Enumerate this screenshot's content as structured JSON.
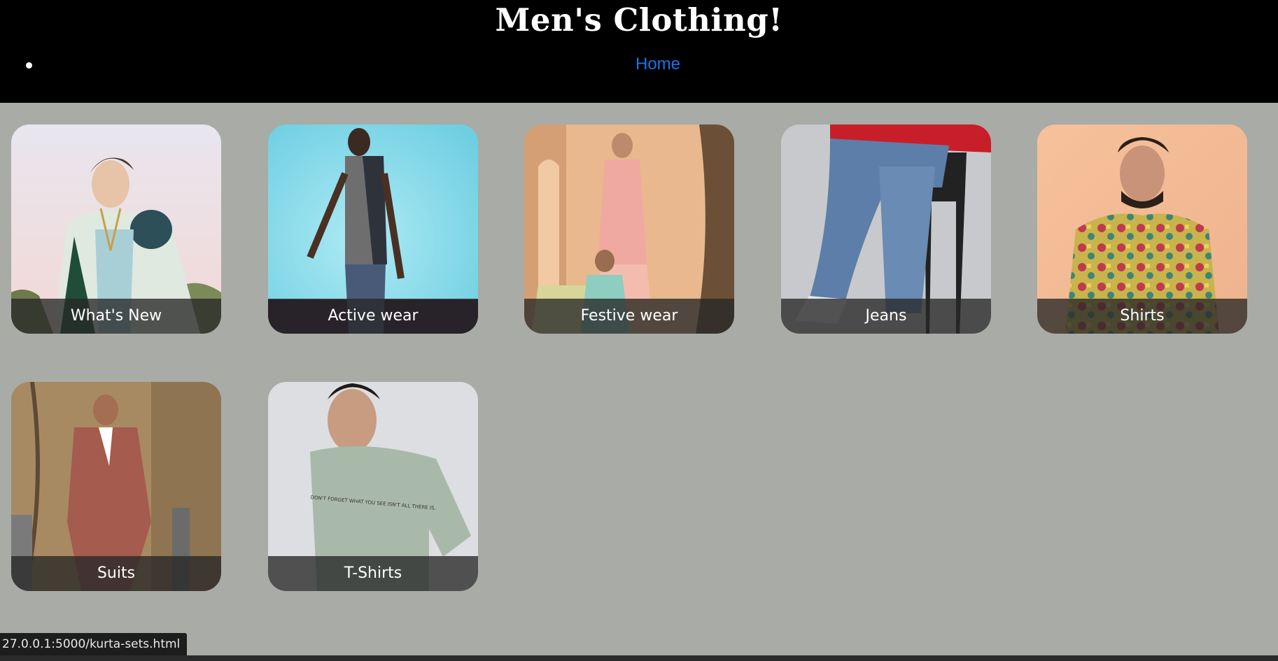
{
  "header": {
    "title": "Men's Clothing!",
    "nav": [
      {
        "label": "Home"
      }
    ]
  },
  "cards": [
    {
      "label": "What's New",
      "icon": "model-in-fur-jacket-photo"
    },
    {
      "label": "Active wear",
      "icon": "model-in-activewear-photo"
    },
    {
      "label": "Festive wear",
      "icon": "models-in-kurta-photo"
    },
    {
      "label": "Jeans",
      "icon": "model-in-jeans-photo"
    },
    {
      "label": "Shirts",
      "icon": "model-in-printed-shirt-photo"
    },
    {
      "label": "Suits",
      "icon": "model-in-suit-photo"
    },
    {
      "label": "T-Shirts",
      "icon": "model-in-tshirt-photo"
    }
  ],
  "tshirt_print": "DON'T FORGET WHAT YOU SEE ISN'T ALL THERE IS.",
  "status_bar": {
    "url": "27.0.0.1:5000/kurta-sets.html"
  },
  "colors": {
    "header_bg": "#000000",
    "page_bg": "#a9aba6",
    "link": "#1a73e8"
  }
}
